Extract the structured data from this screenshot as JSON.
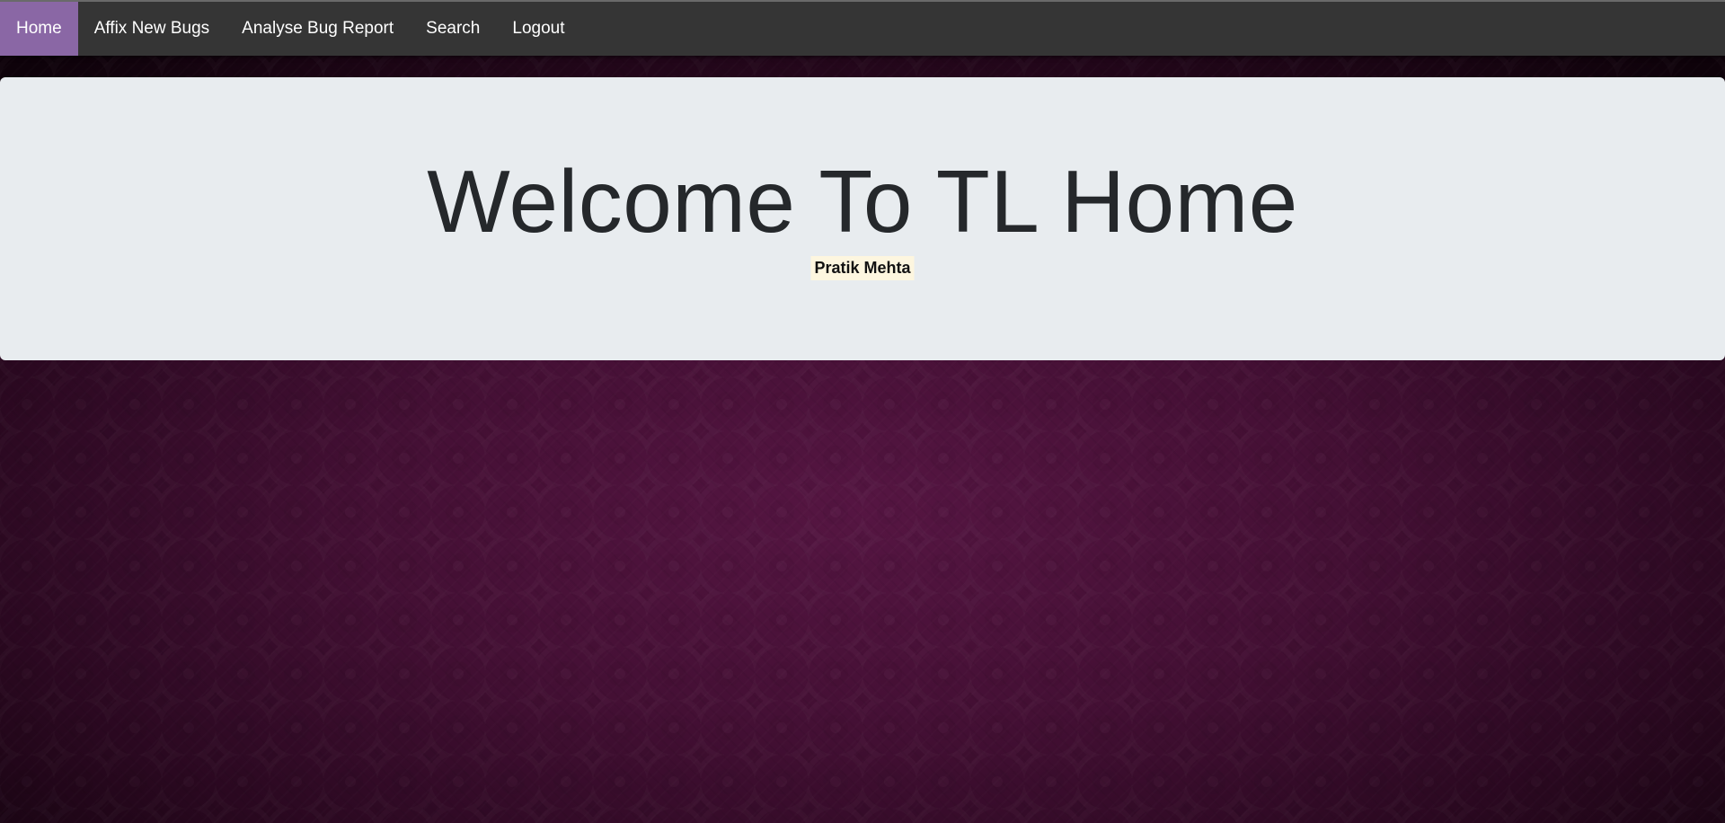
{
  "navbar": {
    "items": [
      {
        "label": "Home",
        "active": true
      },
      {
        "label": "Affix New Bugs",
        "active": false
      },
      {
        "label": "Analyse Bug Report",
        "active": false
      },
      {
        "label": "Search",
        "active": false
      },
      {
        "label": "Logout",
        "active": false
      }
    ]
  },
  "hero": {
    "title": "Welcome To TL Home",
    "user_name": "Pratik Mehta"
  },
  "colors": {
    "navbar_bg": "#353535",
    "active_item_bg": "#8a67a5",
    "hero_bg": "#e8ecef",
    "name_highlight": "#fdf6df",
    "page_bg": "#4a1240"
  }
}
